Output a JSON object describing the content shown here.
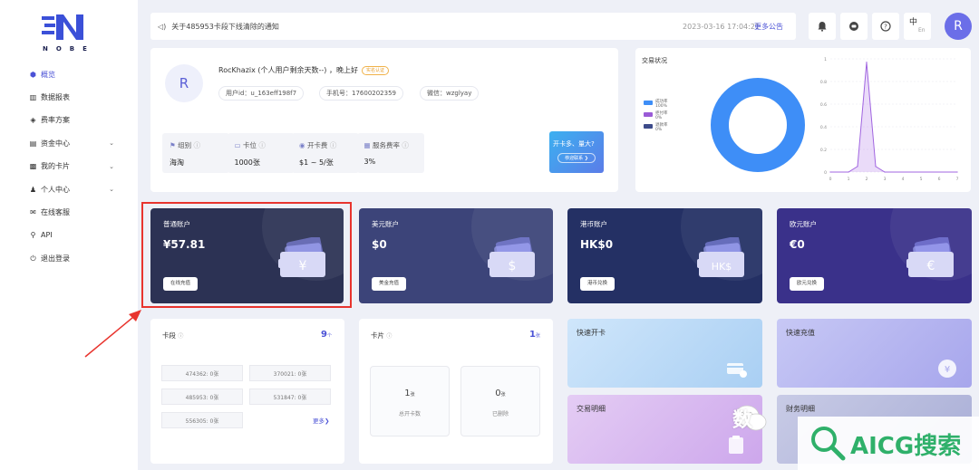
{
  "brand": {
    "logo_text": "NOBE"
  },
  "sidebar": {
    "items": [
      {
        "label": "概览",
        "icon": "home-icon",
        "active": true
      },
      {
        "label": "数据报表",
        "icon": "chart-icon"
      },
      {
        "label": "费率方案",
        "icon": "plan-icon"
      },
      {
        "label": "资金中心",
        "icon": "wallet-icon",
        "chevron": true
      },
      {
        "label": "我的卡片",
        "icon": "card-icon",
        "chevron": true
      },
      {
        "label": "个人中心",
        "icon": "user-icon",
        "chevron": true
      },
      {
        "label": "在线客服",
        "icon": "service-icon"
      },
      {
        "label": "API",
        "icon": "api-icon"
      },
      {
        "label": "退出登录",
        "icon": "power-icon"
      }
    ]
  },
  "topbar": {
    "notice": "关于485953卡段下线清除的通知",
    "date": "2023-03-16 17:04:21",
    "more": "更多公告",
    "lang_zh": "中",
    "lang_en": "En"
  },
  "user": {
    "avatar": "R",
    "greeting": "RocKhazix (个人用户剩余天数--) ，晚上好",
    "badge": "实名认证",
    "uid": "用户id：u_163eff198f7",
    "phone": "手机号：17600202359",
    "wechat": "微信：wzglyay"
  },
  "stats": [
    {
      "label": "组别",
      "value": "海淘"
    },
    {
      "label": "卡位",
      "value": "1000张"
    },
    {
      "label": "开卡费",
      "value": "$1 ~ 5/张"
    },
    {
      "label": "服务费率",
      "value": "3%"
    }
  ],
  "promo": {
    "title": "开卡多、量大?",
    "button": "恭迎联系 ❯"
  },
  "chart_data": [
    {
      "type": "pie",
      "title": "交易状况",
      "series": [
        {
          "name": "成功率",
          "value": 100,
          "label": "100%",
          "color": "#3e8ef7"
        },
        {
          "name": "拒付率",
          "value": 0,
          "label": "0%",
          "color": "#9a5bd6"
        },
        {
          "name": "退款率",
          "value": 0,
          "label": "0%",
          "color": "#3d4b8a"
        }
      ]
    },
    {
      "type": "line",
      "x": [
        0,
        1,
        2,
        3,
        4,
        5,
        6,
        7
      ],
      "xlim": [
        0,
        7
      ],
      "ylim": [
        0,
        1
      ],
      "yticks": [
        "0",
        "0.2",
        "0.4",
        "0.6",
        "0.8",
        "1"
      ],
      "series": [
        {
          "x": [
            0,
            1,
            1.5,
            1.8,
            2,
            2.2,
            2.5,
            3,
            7
          ],
          "values": [
            0,
            0,
            0.05,
            0.6,
            0.97,
            0.6,
            0.05,
            0,
            0
          ]
        }
      ]
    }
  ],
  "accounts": [
    {
      "title": "普通账户",
      "amount": "¥57.81",
      "button": "在线充值",
      "symbol": "¥",
      "bg": "#2c3254"
    },
    {
      "title": "美元账户",
      "amount": "$0",
      "button": "美金充值",
      "symbol": "$",
      "bg": "#3c4479"
    },
    {
      "title": "港币账户",
      "amount": "HK$0",
      "button": "港币兑换",
      "symbol": "HK$",
      "bg": "#243064"
    },
    {
      "title": "欧元账户",
      "amount": "€0",
      "button": "欧元兑换",
      "symbol": "€",
      "bg": "#3a318a"
    }
  ],
  "segments": {
    "title": "卡段",
    "count": "9",
    "unit": "个",
    "items": [
      "474362: 0张",
      "370021: 0张",
      "485953: 0张",
      "531847: 0张",
      "556305: 0张"
    ],
    "more": "更多❯"
  },
  "cards": {
    "title": "卡片",
    "count": "1",
    "unit": "张",
    "opened": "1",
    "opened_unit": "张",
    "opened_label": "总开卡数",
    "deleted": "0",
    "deleted_unit": "张",
    "deleted_label": "已删除"
  },
  "quick": [
    {
      "label": "快速开卡"
    },
    {
      "label": "快速充值"
    },
    {
      "label": "交易明细"
    },
    {
      "label": "财务明细"
    }
  ],
  "watermark": {
    "brand": "AICG搜索",
    "side": "数"
  }
}
